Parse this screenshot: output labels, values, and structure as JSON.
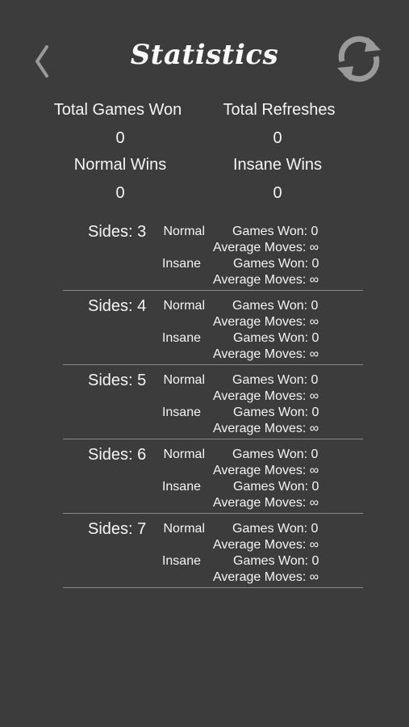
{
  "header": {
    "title": "Statistics"
  },
  "summary": {
    "total_games_won_label": "Total Games Won",
    "total_games_won_value": "0",
    "total_refreshes_label": "Total Refreshes",
    "total_refreshes_value": "0",
    "normal_wins_label": "Normal Wins",
    "normal_wins_value": "0",
    "insane_wins_label": "Insane Wins",
    "insane_wins_value": "0"
  },
  "sides": [
    {
      "label": "Sides: 3",
      "normal": {
        "mode": "Normal",
        "games_won": "Games Won: 0",
        "avg_moves": "Average Moves: ∞"
      },
      "insane": {
        "mode": "Insane",
        "games_won": "Games Won: 0",
        "avg_moves": "Average Moves: ∞"
      }
    },
    {
      "label": "Sides: 4",
      "normal": {
        "mode": "Normal",
        "games_won": "Games Won: 0",
        "avg_moves": "Average Moves: ∞"
      },
      "insane": {
        "mode": "Insane",
        "games_won": "Games Won: 0",
        "avg_moves": "Average Moves: ∞"
      }
    },
    {
      "label": "Sides: 5",
      "normal": {
        "mode": "Normal",
        "games_won": "Games Won: 0",
        "avg_moves": "Average Moves: ∞"
      },
      "insane": {
        "mode": "Insane",
        "games_won": "Games Won: 0",
        "avg_moves": "Average Moves: ∞"
      }
    },
    {
      "label": "Sides: 6",
      "normal": {
        "mode": "Normal",
        "games_won": "Games Won: 0",
        "avg_moves": "Average Moves: ∞"
      },
      "insane": {
        "mode": "Insane",
        "games_won": "Games Won: 0",
        "avg_moves": "Average Moves: ∞"
      }
    },
    {
      "label": "Sides: 7",
      "normal": {
        "mode": "Normal",
        "games_won": "Games Won: 0",
        "avg_moves": "Average Moves: ∞"
      },
      "insane": {
        "mode": "Insane",
        "games_won": "Games Won: 0",
        "avg_moves": "Average Moves: ∞"
      }
    }
  ],
  "colors": {
    "background": "#3c3c3c",
    "text": "#f4f4f4",
    "icon": "#9a9a9a",
    "divider": "#8a8a8a"
  },
  "icons": {
    "back": "chevron-left-icon",
    "refresh": "refresh-icon"
  }
}
